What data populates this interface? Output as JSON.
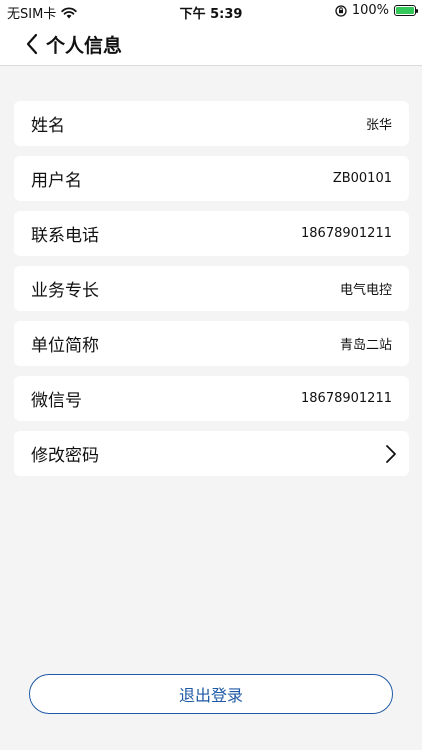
{
  "status_bar": {
    "carrier": "无SIM卡",
    "time": "下午 5:39",
    "battery": "100%",
    "icons": [
      "wifi-icon",
      "orientation-lock-icon",
      "battery-charging-icon"
    ]
  },
  "header": {
    "title": "个人信息",
    "back_icon": "chevron-left-icon"
  },
  "rows": [
    {
      "label": "姓名",
      "value": "张华"
    },
    {
      "label": "用户名",
      "value": "ZB00101"
    },
    {
      "label": "联系电话",
      "value": "18678901211"
    },
    {
      "label": "业务专长",
      "value": "电气电控"
    },
    {
      "label": "单位简称",
      "value": "青岛二站"
    },
    {
      "label": "微信号",
      "value": "18678901211"
    },
    {
      "label": "修改密码",
      "value": ""
    }
  ],
  "logout_label": "退出登录",
  "colors": {
    "accent": "#1f5aa6",
    "background": "#f4f4f5",
    "card": "#ffffff",
    "battery_fill": "#34c759"
  }
}
